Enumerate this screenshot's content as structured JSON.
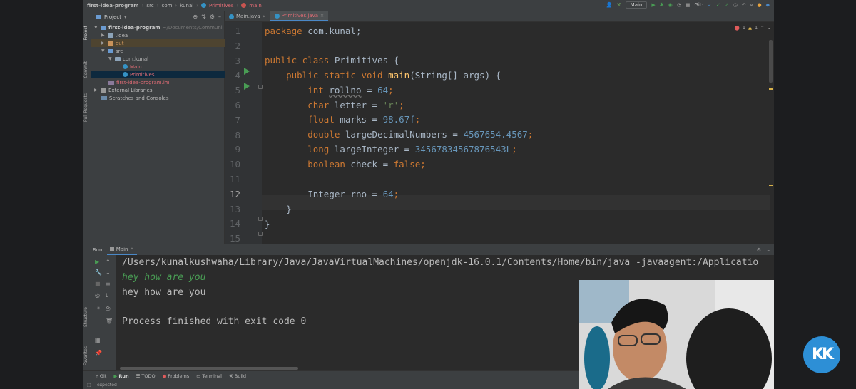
{
  "breadcrumb": [
    "first-idea-program",
    "src",
    "com",
    "kunal",
    "Primitives",
    "main"
  ],
  "toolbar": {
    "run_config": "Main",
    "git_label": "Git:"
  },
  "project_panel": {
    "title": "Project",
    "tree": [
      {
        "label": "first-idea-program",
        "path": "~/Documents/Communi"
      },
      {
        "label": ".idea"
      },
      {
        "label": "out"
      },
      {
        "label": "src"
      },
      {
        "label": "com.kunal"
      },
      {
        "label": "Main"
      },
      {
        "label": "Primitives"
      },
      {
        "label": "first-idea-program.iml"
      },
      {
        "label": "External Libraries"
      },
      {
        "label": "Scratches and Consoles"
      }
    ]
  },
  "left_strip": [
    "Project",
    "Commit",
    "Pull Requests",
    "Structure",
    "Favorites"
  ],
  "editor": {
    "tabs": [
      "Main.java",
      "Primitives.java"
    ],
    "active_tab": "Primitives.java",
    "inspection": {
      "errors": "1",
      "warnings": "1"
    },
    "line_numbers": [
      "1",
      "2",
      "3",
      "4",
      "5",
      "6",
      "7",
      "8",
      "9",
      "10",
      "11",
      "12",
      "13",
      "14",
      "15"
    ],
    "code": {
      "l1": {
        "kw": "package",
        "rest": " com.kunal;"
      },
      "l3": {
        "kw": "public class",
        "rest": " Primitives {"
      },
      "l4": {
        "kw": "public static void",
        "fn": "main",
        "rest": "(String[] args) {"
      },
      "l5": {
        "type": "int",
        "name": "rollno",
        "eq": " = ",
        "val": "64",
        "end": ";"
      },
      "l6": {
        "type": "char",
        "name": " letter = ",
        "val": "'r'",
        "end": ";"
      },
      "l7": {
        "type": "float",
        "name": " marks = ",
        "val": "98.67f",
        "end": ";"
      },
      "l8": {
        "type": "double",
        "name": " largeDecimalNumbers = ",
        "val": "4567654.4567",
        "end": ";"
      },
      "l9": {
        "type": "long",
        "name": " largeInteger = ",
        "val": "34567834567876543L",
        "end": ";"
      },
      "l10": {
        "type": "boolean",
        "name": " check = ",
        "val": "false",
        "end": ";"
      },
      "l12": {
        "type": "Integer",
        "name": " rno = ",
        "val": "64",
        "end": ";"
      },
      "l13": "}",
      "l14": "}"
    }
  },
  "run_panel": {
    "label": "Run:",
    "tab": "Main",
    "output": [
      "/Users/kunalkushwaha/Library/Java/JavaVirtualMachines/openjdk-16.0.1/Contents/Home/bin/java -javaagent:/Applicatio",
      "hey how are you",
      "hey how are you",
      "Process finished with exit code 0"
    ]
  },
  "bottom_tabs": [
    "Git",
    "Run",
    "TODO",
    "Problems",
    "Terminal",
    "Build"
  ],
  "status": "expected",
  "logo_text": "KK",
  "colors": {
    "keyword": "#cc7832",
    "number": "#6897bb",
    "string": "#6a8759",
    "function": "#ffc66d",
    "accent": "#4a88c7"
  }
}
